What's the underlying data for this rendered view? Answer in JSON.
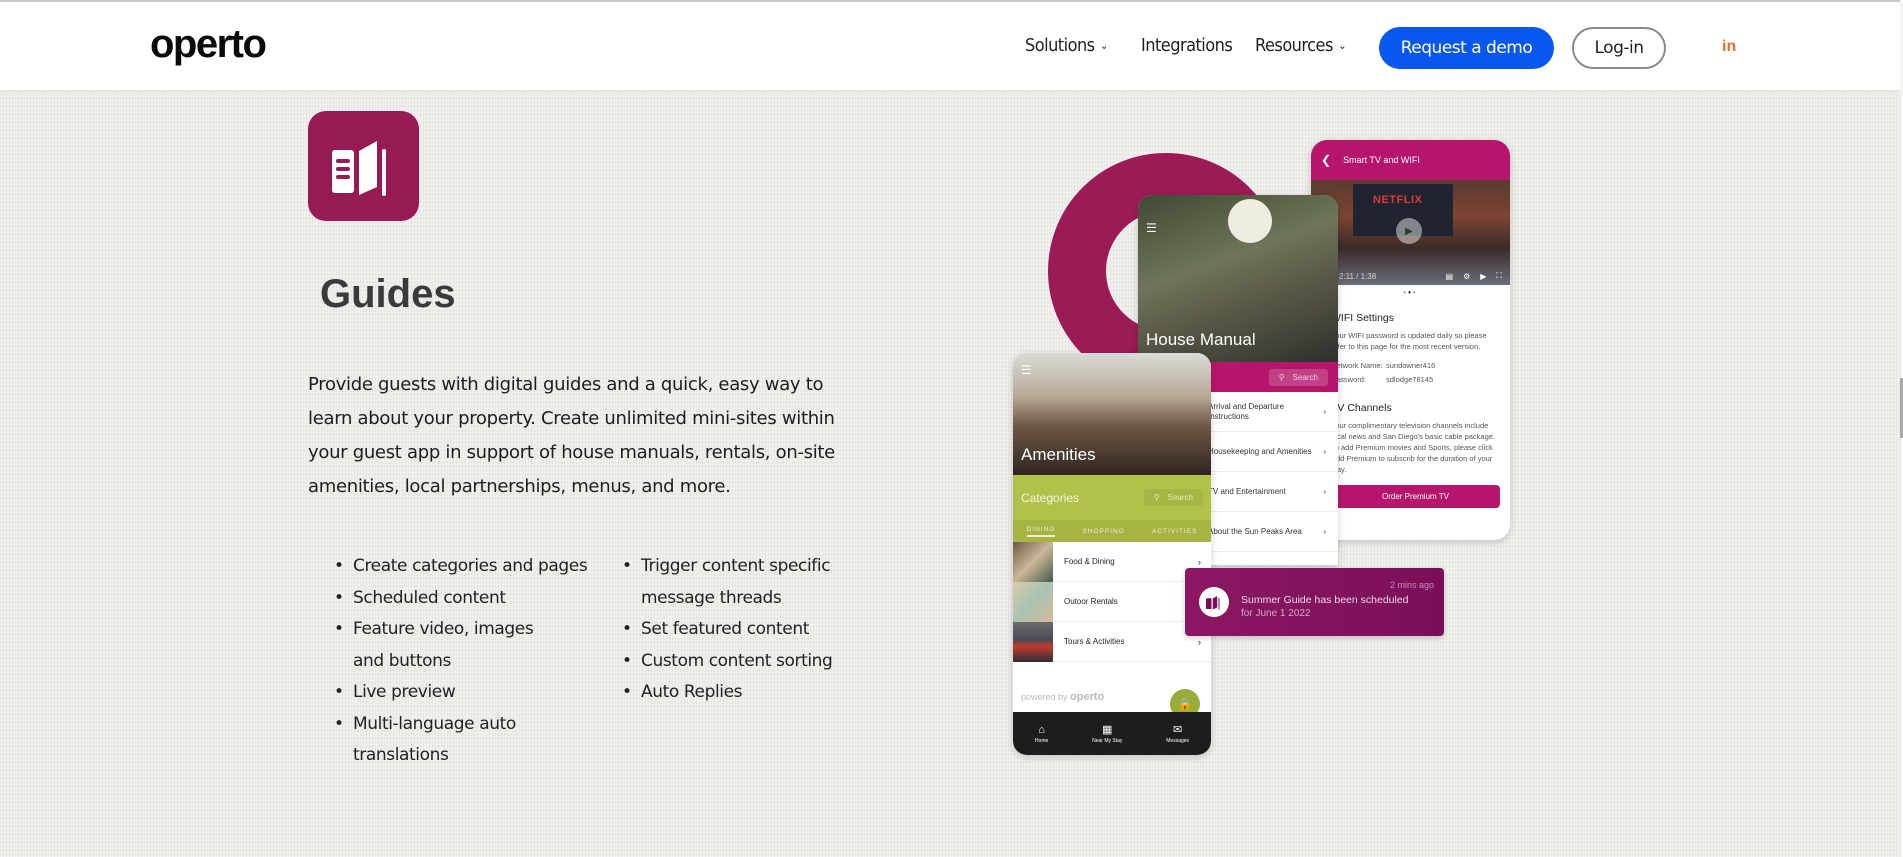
{
  "header": {
    "logo": "operto",
    "nav": [
      {
        "label": "Solutions",
        "has_dropdown": true
      },
      {
        "label": "Integrations",
        "has_dropdown": false
      },
      {
        "label": "Resources",
        "has_dropdown": true
      }
    ],
    "cta_label": "Request a demo",
    "login_label": "Log-in",
    "social_icon": "linkedin-icon",
    "social_label": "in",
    "colors": {
      "cta": "#0a57f0",
      "social": "#e2702a"
    }
  },
  "section": {
    "icon": "guide-book-icon",
    "icon_color": "#961a54",
    "title": "Guides",
    "description": "Provide guests with digital guides and a quick, easy way to learn about your property. Create unlimited mini-sites within your guest app in support of house manuals, rentals, on-site amenities, local partnerships, menus, and more.",
    "features_col1": [
      "Create categories and pages",
      "Scheduled content",
      "Feature video, images and buttons",
      "Live preview",
      "Multi-language auto translations"
    ],
    "features_col2": [
      "Trigger content specific message threads",
      "Set featured content",
      "Custom content sorting",
      "Auto Replies"
    ]
  },
  "mockup": {
    "tv_phone": {
      "header": "Smart TV and WIFI",
      "video_brand": "NETFLIX",
      "video_time": "2:11 / 1:38",
      "wifi_heading": "WIFI Settings",
      "wifi_text": "Your WIFI password is updated daily so please refer to this page for the most recent version.",
      "network_label": "Network Name:",
      "network_value": "sundowner416",
      "password_label": "Password:",
      "password_value": "sdlodge78145",
      "channels_heading": "TV Channels",
      "channels_text": "Your complimentary television channels include local news and San Diego's basic cable package. To add Premium movies and Sports, please click Add Premium to subscrib for the duration of your stay.",
      "order_button": "Order Premium TV"
    },
    "house_phone": {
      "title": "House Manual",
      "search_placeholder": "Search",
      "rows": [
        "Arrival and Departure Instructions",
        "Housekeeping and Amenities",
        "TV and Entertainment",
        "About the Sun Peaks Area"
      ]
    },
    "amenities_phone": {
      "title": "Amenities",
      "categories_label": "Categories",
      "search_placeholder": "Search",
      "tabs": [
        "DINING",
        "SHOPPING",
        "ACTIVITIES"
      ],
      "rows": [
        "Food & Dining",
        "Outoor Rentals",
        "Tours & Activities"
      ],
      "powered_by": "powered by",
      "powered_brand": "operto",
      "bottom_nav": [
        {
          "label": "Home",
          "icon": "home-icon"
        },
        {
          "label": "Near My Stay",
          "icon": "map-icon"
        },
        {
          "label": "Messages",
          "icon": "message-icon"
        }
      ]
    },
    "notification": {
      "time": "2 mins ago",
      "text": "Summer Guide has been scheduled",
      "subtext": "for June 1 2022"
    },
    "colors": {
      "brand": "#b5166b",
      "ring": "#9c1b57",
      "green": "#b2c14a"
    }
  }
}
